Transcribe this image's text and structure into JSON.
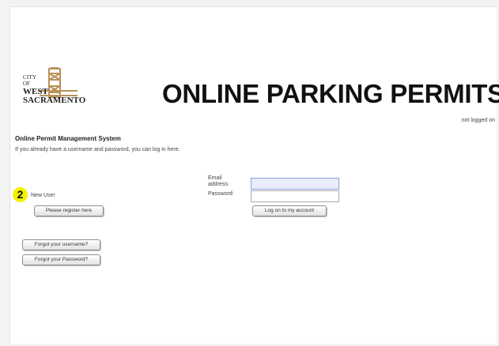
{
  "logo": {
    "city": "CITY",
    "of": "OF",
    "west": "WEST",
    "sacramento": "SACRAMENTO"
  },
  "header": {
    "title": "ONLINE PARKING PERMITS",
    "login_status": "not logged on"
  },
  "main": {
    "heading": "Online Permit Management System",
    "intro": "If you already have a username and password, you can log in here."
  },
  "new_user": {
    "step_number": "2",
    "label": "New User",
    "register_button": "Please register here"
  },
  "login": {
    "email_label": "Email address:",
    "email_value": "",
    "password_label": "Password:",
    "password_value": "",
    "logon_button": "Log on to my account"
  },
  "recovery": {
    "forgot_username": "Forgot your username?",
    "forgot_password": "Forgot your Password?"
  },
  "colors": {
    "badge": "#f4f000",
    "email_field_bg": "#e8ecfb"
  }
}
